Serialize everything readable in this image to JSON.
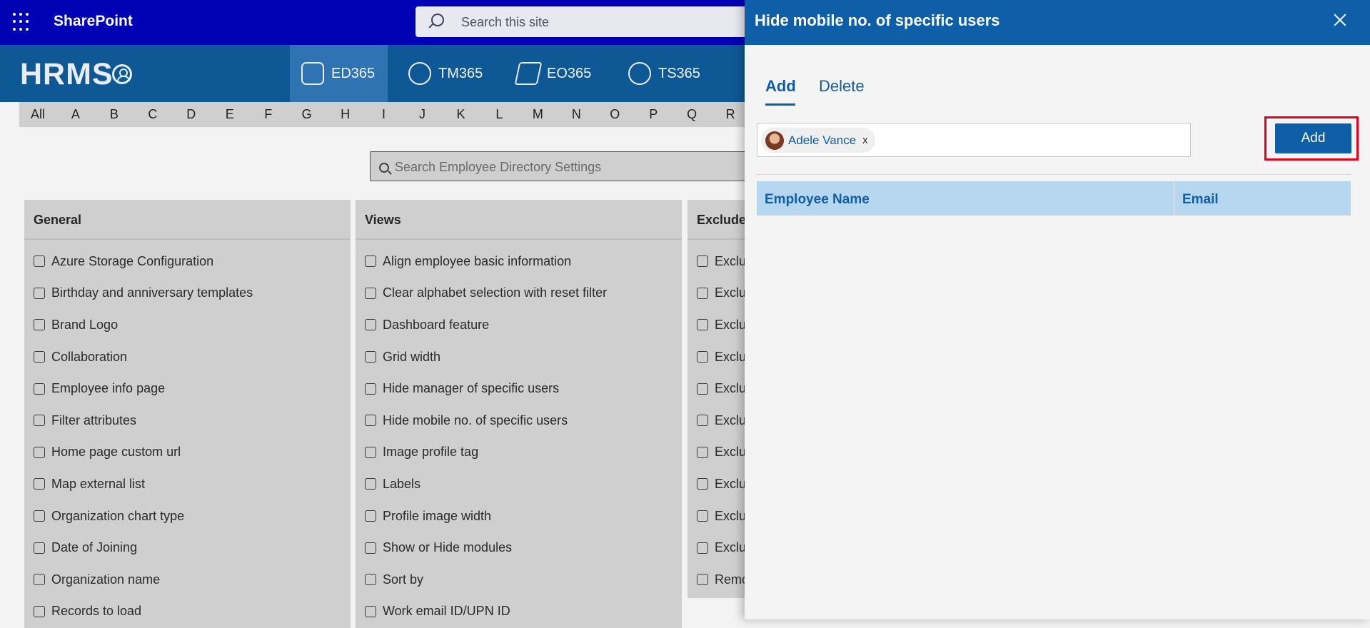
{
  "suite": {
    "app_name": "SharePoint",
    "search_placeholder": "Search this site"
  },
  "app": {
    "logo": "HRMS",
    "nav": [
      {
        "label": "ED365",
        "active": true
      },
      {
        "label": "TM365",
        "active": false
      },
      {
        "label": "EO365",
        "active": false
      },
      {
        "label": "TS365",
        "active": false
      }
    ]
  },
  "alphabet": [
    "All",
    "A",
    "B",
    "C",
    "D",
    "E",
    "F",
    "G",
    "H",
    "I",
    "J",
    "K",
    "L",
    "M",
    "N",
    "O",
    "P",
    "Q",
    "R"
  ],
  "directory_search_placeholder": "Search Employee Directory Settings",
  "cards": [
    {
      "title": "General",
      "items": [
        "Azure Storage Configuration",
        "Birthday and anniversary templates",
        "Brand Logo",
        "Collaboration",
        "Employee info page",
        "Filter attributes",
        "Home page custom url",
        "Map external list",
        "Organization chart type",
        "Date of Joining",
        "Organization name",
        "Records to load"
      ]
    },
    {
      "title": "Views",
      "items": [
        "Align employee basic information",
        "Clear alphabet selection with reset filter",
        "Dashboard feature",
        "Grid width",
        "Hide manager of specific users",
        "Hide mobile no. of specific users",
        "Image profile tag",
        "Labels",
        "Profile image width",
        "Show or Hide modules",
        "Sort by",
        "Work email ID/UPN ID"
      ]
    },
    {
      "title": "Exclude",
      "items": [
        "Exclu",
        "Exclu",
        "Exclu",
        "Exclu",
        "Exclu",
        "Exclu",
        "Exclu",
        "Exclu",
        "Exclu",
        "Exclu",
        "Remo"
      ]
    }
  ],
  "panel": {
    "title": "Hide mobile no. of specific users",
    "tabs": {
      "add": "Add",
      "delete": "Delete"
    },
    "selected_user": "Adele Vance",
    "remove_symbol": "x",
    "add_button": "Add",
    "table_headers": {
      "name": "Employee Name",
      "email": "Email"
    }
  }
}
